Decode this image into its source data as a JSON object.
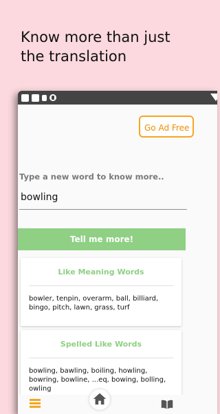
{
  "headline": "Know more than just the translation",
  "ad_button": "Go Ad Free",
  "prompt": "Type a new word to know more..",
  "input_value": "bowling",
  "tell_button": "Tell me more!",
  "cards": [
    {
      "title": "Like Meaning Words",
      "body": "bowler, tenpin, overarm, ball, billiard, bingo, pitch, lawn, grass, turf"
    },
    {
      "title": "Spelled Like Words",
      "body": "bowling, bawling, boiling, howling, bowring, bowline, ...eq, bowing, bolling, owling"
    }
  ],
  "nav": {
    "list_icon": "list-icon",
    "home_icon": "home-icon",
    "book_icon": "book-icon"
  },
  "colors": {
    "background": "#fbd9de",
    "accent_green": "#8fd084",
    "accent_orange": "#f5a623"
  }
}
